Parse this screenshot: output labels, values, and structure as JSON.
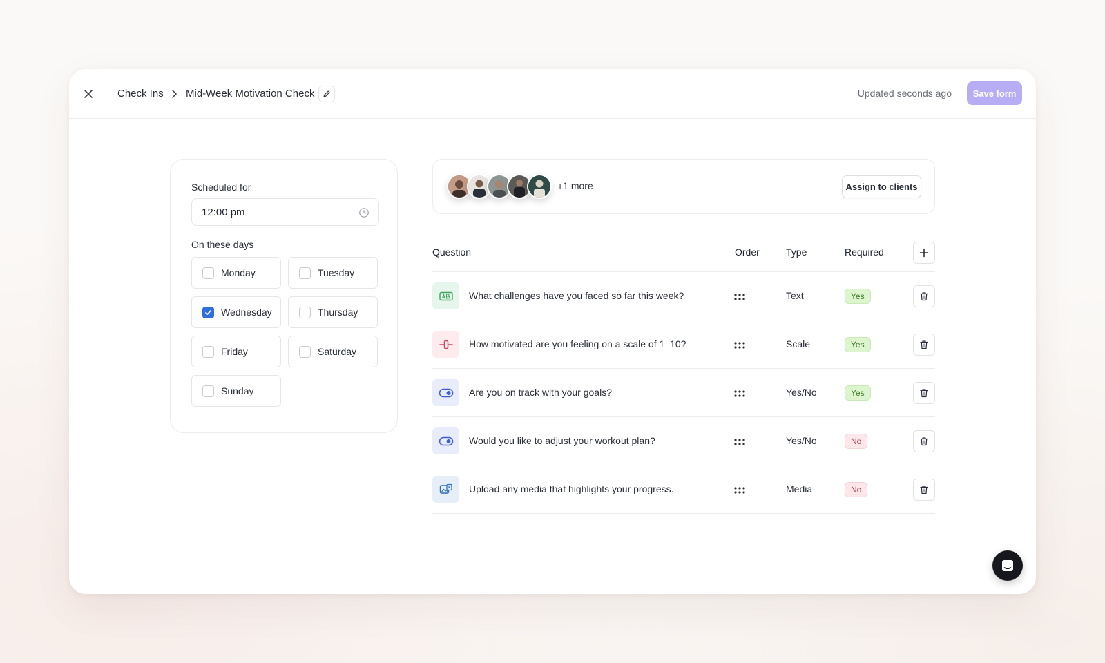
{
  "topbar": {
    "breadcrumb_root": "Check Ins",
    "form_title": "Mid-Week Motivation Check",
    "updated_text": "Updated seconds ago",
    "save_label": "Save form"
  },
  "schedule": {
    "scheduled_label": "Scheduled for",
    "time_value": "12:00 pm",
    "days_label": "On these days",
    "days": [
      {
        "label": "Monday",
        "checked": false
      },
      {
        "label": "Tuesday",
        "checked": false
      },
      {
        "label": "Wednesday",
        "checked": true
      },
      {
        "label": "Thursday",
        "checked": false
      },
      {
        "label": "Friday",
        "checked": false
      },
      {
        "label": "Saturday",
        "checked": false
      },
      {
        "label": "Sunday",
        "checked": false
      }
    ]
  },
  "clients": {
    "more_text": "+1 more",
    "assign_label": "Assign to clients"
  },
  "table": {
    "headers": {
      "question": "Question",
      "order": "Order",
      "type": "Type",
      "required": "Required"
    },
    "rows": [
      {
        "icon": "text-icon",
        "question": "What challenges have you faced so far this week?",
        "type": "Text",
        "required": "Yes"
      },
      {
        "icon": "scale-icon",
        "question": "How motivated are you feeling on a scale of 1–10?",
        "type": "Scale",
        "required": "Yes"
      },
      {
        "icon": "toggle-icon",
        "question": "Are you on track with your goals?",
        "type": "Yes/No",
        "required": "Yes"
      },
      {
        "icon": "toggle-icon",
        "question": "Would you like to adjust your workout plan?",
        "type": "Yes/No",
        "required": "No"
      },
      {
        "icon": "media-icon",
        "question": "Upload any media that highlights your progress.",
        "type": "Media",
        "required": "No"
      }
    ]
  },
  "colors": {
    "accent": "#b7adf4",
    "checkbox_checked": "#2f6fde",
    "yes_badge": "#dcf5cf",
    "no_badge": "#fde7ea"
  }
}
